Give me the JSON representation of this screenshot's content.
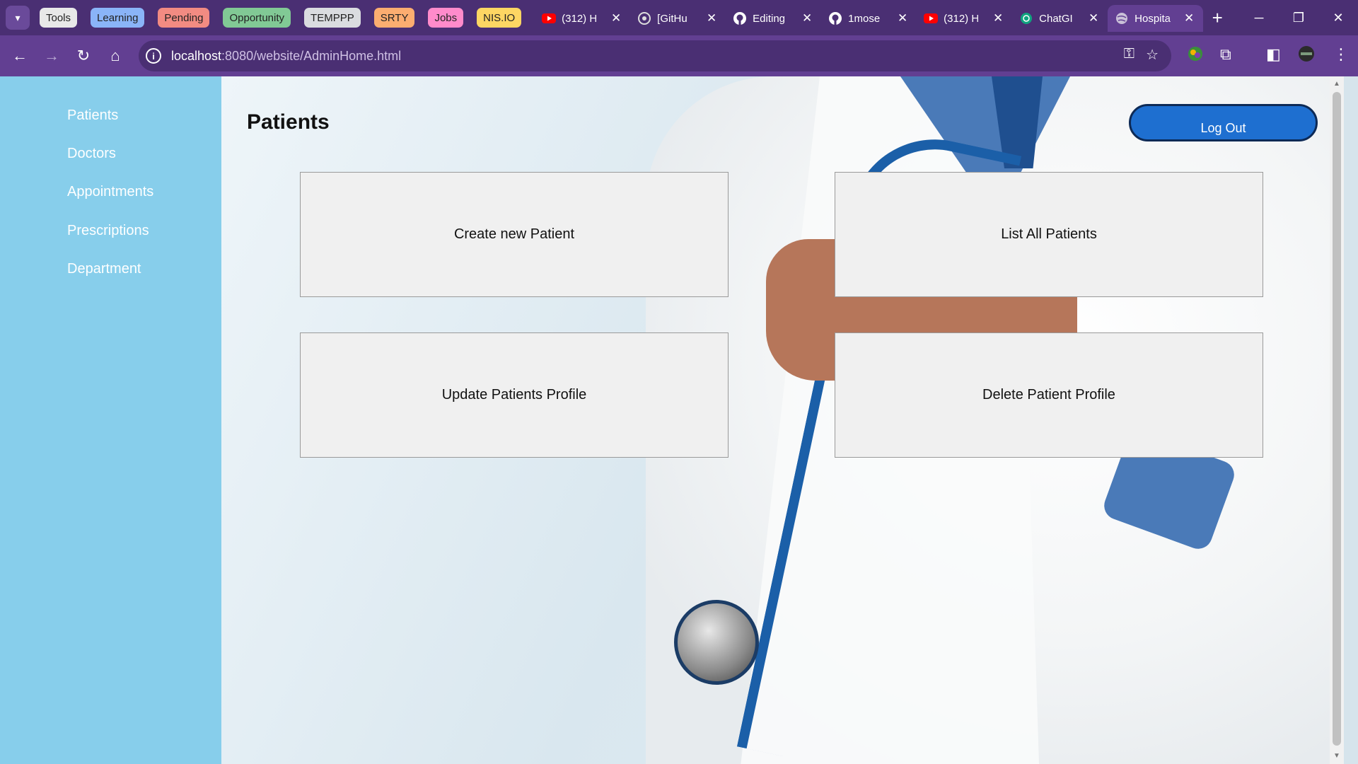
{
  "browser": {
    "tab_groups": [
      {
        "label": "Tools",
        "color": "#e8e8e8"
      },
      {
        "label": "Learning",
        "color": "#8ab4f8"
      },
      {
        "label": "Pending",
        "color": "#f28b82"
      },
      {
        "label": "Opportunity",
        "color": "#81c995"
      },
      {
        "label": "TEMPPP",
        "color": "#dadce0"
      },
      {
        "label": "SRTY",
        "color": "#fcad70"
      },
      {
        "label": "Jobs",
        "color": "#ff8bcb"
      },
      {
        "label": "NIS.IO",
        "color": "#fdd663"
      }
    ],
    "tabs": [
      {
        "title": "(312) H",
        "icon": "youtube-icon"
      },
      {
        "title": "[GitHu",
        "icon": "github-copilot-icon"
      },
      {
        "title": "Editing",
        "icon": "github-icon"
      },
      {
        "title": "1mose",
        "icon": "github-icon"
      },
      {
        "title": "(312) H",
        "icon": "youtube-icon"
      },
      {
        "title": "ChatGI",
        "icon": "chatgpt-icon"
      },
      {
        "title": "Hospita",
        "icon": "globe-icon",
        "active": true
      }
    ],
    "url_host": "localhost",
    "url_rest": ":8080/website/AdminHome.html"
  },
  "sidebar": {
    "items": [
      {
        "label": "Patients"
      },
      {
        "label": "Doctors"
      },
      {
        "label": "Appointments"
      },
      {
        "label": "Prescriptions"
      },
      {
        "label": "Department"
      }
    ]
  },
  "main": {
    "title": "Patients",
    "logout_label": "Log Out",
    "cards": [
      {
        "label": "Create new Patient"
      },
      {
        "label": "List All Patients"
      },
      {
        "label": "Update Patients Profile"
      },
      {
        "label": "Delete Patient Profile"
      }
    ]
  },
  "colors": {
    "sidebar": "#87ceeb",
    "logout_button": "#1e6fd0",
    "browser_frame": "#623f92"
  }
}
